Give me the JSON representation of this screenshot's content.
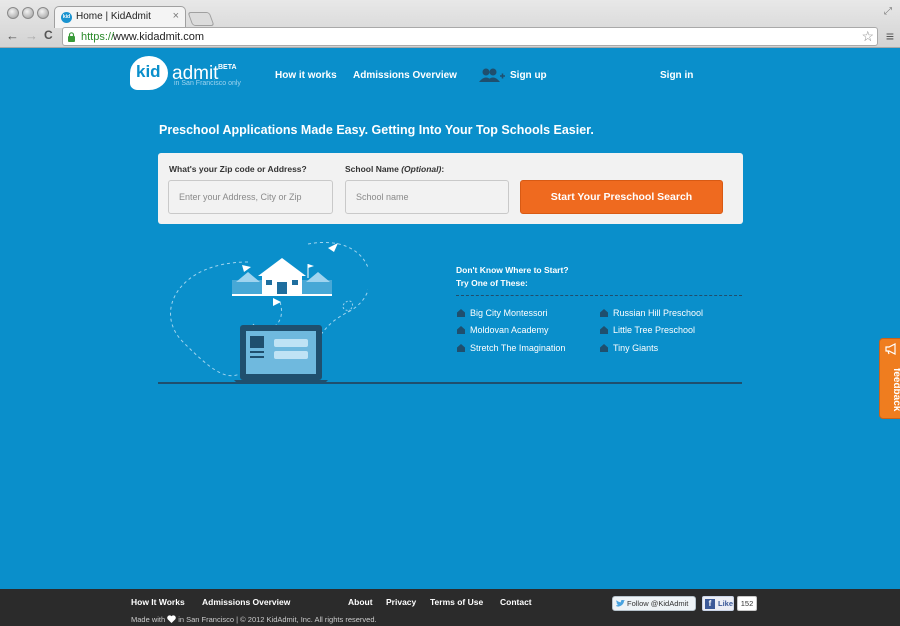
{
  "browser": {
    "tab_title": "Home | KidAdmit",
    "tab_close": "×",
    "url_scheme": "https://",
    "url_rest": "www.kidadmit.com",
    "back": "←",
    "forward": "→",
    "reload": "C",
    "star": "☆",
    "menu": "≡",
    "fullscreen": "⤢"
  },
  "header": {
    "logo_kid": "kid",
    "logo_admit": "admit",
    "logo_beta": "BETA",
    "logo_tagline": "in San Francisco only",
    "nav": {
      "how_it_works": "How it works",
      "admissions_overview": "Admissions Overview",
      "sign_up": "Sign up",
      "sign_in": "Sign in"
    }
  },
  "hero": {
    "headline": "Preschool Applications Made Easy. Getting Into Your Top Schools Easier.",
    "zip_label": "What's your Zip code or Address?",
    "zip_placeholder": "Enter your Address, City or Zip",
    "school_label_main": "School Name ",
    "school_label_optional": "(Optional)",
    "school_label_colon": ":",
    "school_placeholder": "School name",
    "search_button": "Start Your Preschool Search"
  },
  "suggestions": {
    "title_line1": "Don't Know Where to Start?",
    "title_line2": "Try One of These:",
    "schools": [
      "Big City Montessori",
      "Moldovan Academy",
      "Stretch The Imagination",
      "Russian Hill Preschool",
      "Little Tree Preschool",
      "Tiny Giants"
    ]
  },
  "feedback": {
    "label": "feedback"
  },
  "footer": {
    "links": {
      "how_it_works": "How It Works",
      "admissions_overview": "Admissions Overview",
      "about": "About",
      "privacy": "Privacy",
      "terms": "Terms of Use",
      "contact": "Contact"
    },
    "credit_before": "Made with",
    "credit_after": "in San Francisco | © 2012 KidAdmit, Inc. All rights reserved.",
    "twitter": "Follow @KidAdmit",
    "fb_like": "Like",
    "fb_count": "152"
  },
  "colors": {
    "background": "#0a8fcb",
    "accent_orange": "#ef6a1f",
    "footer": "#2b2b2b",
    "ink_dark": "#1f4f6e"
  }
}
